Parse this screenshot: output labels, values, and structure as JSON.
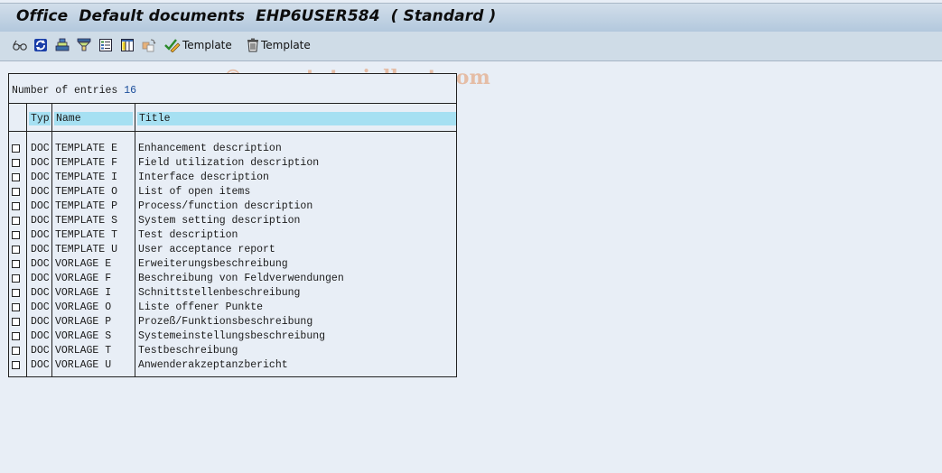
{
  "window": {
    "title": "Office  Default documents  EHP6USER584  ( Standard )"
  },
  "toolbar": {
    "buttons": [
      {
        "icon": "glasses-icon",
        "label": ""
      },
      {
        "icon": "refresh-icon",
        "label": ""
      },
      {
        "icon": "print-icon",
        "label": ""
      },
      {
        "icon": "filter-icon",
        "label": ""
      },
      {
        "icon": "details-list-icon",
        "label": ""
      },
      {
        "icon": "columns-icon",
        "label": ""
      },
      {
        "icon": "copy-icon",
        "label": ""
      },
      {
        "icon": "check-edit-icon",
        "label": "Template"
      },
      {
        "icon": "trash-icon",
        "label": "Template"
      }
    ],
    "watermark": "© www.tutorialkart.com"
  },
  "list": {
    "count_label": "Number of entries",
    "count_value": "16",
    "columns": {
      "typ": "Typ",
      "name": "Name",
      "title": "Title"
    },
    "rows": [
      {
        "typ": "DOC",
        "name": "TEMPLATE E",
        "title": "Enhancement description"
      },
      {
        "typ": "DOC",
        "name": "TEMPLATE F",
        "title": "Field utilization description"
      },
      {
        "typ": "DOC",
        "name": "TEMPLATE I",
        "title": "Interface description"
      },
      {
        "typ": "DOC",
        "name": "TEMPLATE O",
        "title": "List of open items"
      },
      {
        "typ": "DOC",
        "name": "TEMPLATE P",
        "title": "Process/function description"
      },
      {
        "typ": "DOC",
        "name": "TEMPLATE S",
        "title": "System setting description"
      },
      {
        "typ": "DOC",
        "name": "TEMPLATE T",
        "title": "Test description"
      },
      {
        "typ": "DOC",
        "name": "TEMPLATE U",
        "title": "User acceptance report"
      },
      {
        "typ": "DOC",
        "name": "VORLAGE E",
        "title": "Erweiterungsbeschreibung"
      },
      {
        "typ": "DOC",
        "name": "VORLAGE F",
        "title": "Beschreibung von Feldverwendungen"
      },
      {
        "typ": "DOC",
        "name": "VORLAGE I",
        "title": "Schnittstellenbeschreibung"
      },
      {
        "typ": "DOC",
        "name": "VORLAGE O",
        "title": "Liste offener Punkte"
      },
      {
        "typ": "DOC",
        "name": "VORLAGE P",
        "title": "Prozeß/Funktionsbeschreibung"
      },
      {
        "typ": "DOC",
        "name": "VORLAGE S",
        "title": "Systemeinstellungsbeschreibung"
      },
      {
        "typ": "DOC",
        "name": "VORLAGE T",
        "title": "Testbeschreibung"
      },
      {
        "typ": "DOC",
        "name": "VORLAGE U",
        "title": "Anwenderakzeptanzbericht"
      }
    ]
  }
}
